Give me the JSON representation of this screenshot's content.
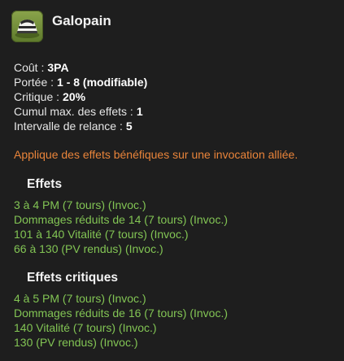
{
  "spell": {
    "name": "Galopain",
    "icon": "galopain-spell-icon"
  },
  "stats": [
    {
      "label": "Coût :",
      "value": "3PA"
    },
    {
      "label": "Portée :",
      "value": "1 - 8 (modifiable)"
    },
    {
      "label": "Critique :",
      "value": "20%"
    },
    {
      "label": "Cumul max. des effets :",
      "value": "1"
    },
    {
      "label": "Intervalle de relance :",
      "value": "5"
    }
  ],
  "description": "Applique des effets bénéfiques sur une invocation alliée.",
  "effects": {
    "title": "Effets",
    "items": [
      "3 à 4 PM (7 tours) (Invoc.)",
      "Dommages réduits de 14 (7 tours) (Invoc.)",
      "101 à 140 Vitalité (7 tours) (Invoc.)",
      "66 à 130 (PV rendus) (Invoc.)"
    ]
  },
  "critical_effects": {
    "title": "Effets critiques",
    "items": [
      "4 à 5 PM (7 tours) (Invoc.)",
      "Dommages réduits de 16 (7 tours) (Invoc.)",
      "140 Vitalité (7 tours) (Invoc.)",
      "130 (PV rendus) (Invoc.)"
    ]
  },
  "colors": {
    "background": "#1e1e1e",
    "description": "#e9843a",
    "effect": "#82c454"
  }
}
